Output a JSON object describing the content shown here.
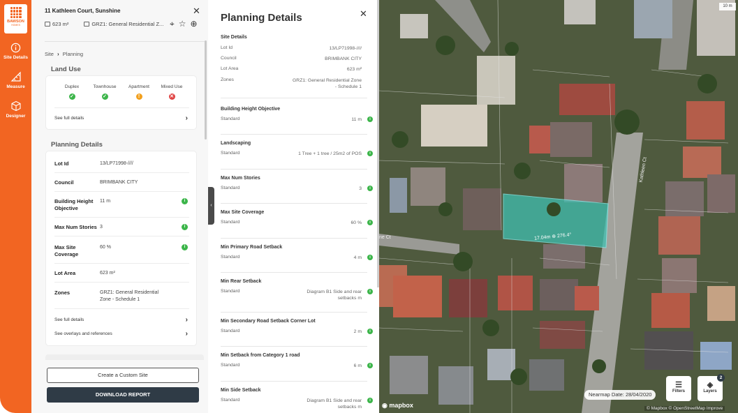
{
  "brand": {
    "line1": "BAWSON",
    "line2": "HOMES"
  },
  "rail": {
    "items": [
      {
        "label": "Site Details"
      },
      {
        "label": "Measure"
      },
      {
        "label": "Designer"
      }
    ]
  },
  "site": {
    "address": "11 Kathleen Court, Sunshine",
    "area": "623 m²",
    "zone_short": "GRZ1: General Residential Z..."
  },
  "breadcrumb": {
    "first": "Site",
    "second": "Planning"
  },
  "land_use": {
    "title": "Land Use",
    "items": [
      {
        "label": "Duplex",
        "status": "green",
        "glyph": "✓"
      },
      {
        "label": "Townhouse",
        "status": "green",
        "glyph": "✓"
      },
      {
        "label": "Apartment",
        "status": "orange",
        "glyph": "!"
      },
      {
        "label": "Mixed Use",
        "status": "red",
        "glyph": "✕"
      }
    ],
    "see_full": "See full details"
  },
  "planning": {
    "title": "Planning Details",
    "rows": [
      {
        "key": "Lot Id",
        "value": "13/LP71998-////"
      },
      {
        "key": "Council",
        "value": "BRIMBANK CITY"
      },
      {
        "key": "Building Height Objective",
        "value": "11 m"
      },
      {
        "key": "Max Num Stories",
        "value": "3"
      },
      {
        "key": "Max Site Coverage",
        "value": "60 %"
      },
      {
        "key": "Lot Area",
        "value": "623 m²"
      },
      {
        "key": "Zones",
        "value": "GRZ1: General Residential Zone - Schedule 1"
      }
    ],
    "see_full": "See full details",
    "see_overlays": "See overlays and references"
  },
  "actions": {
    "custom_site": "Create a Custom Site",
    "download": "DOWNLOAD REPORT"
  },
  "panel": {
    "title": "Planning Details",
    "site_details_title": "Site Details",
    "site_rows": [
      {
        "key": "Lot Id",
        "value": "13/LP71998-////"
      },
      {
        "key": "Council",
        "value": "BRIMBANK CITY"
      },
      {
        "key": "Lot Area",
        "value": "623 m²"
      },
      {
        "key": "Zones",
        "value": "GRZ1: General Residential Zone - Schedule 1"
      }
    ],
    "sections": [
      {
        "title": "Building Height Objective",
        "label": "Standard",
        "value": "11 m"
      },
      {
        "title": "Landscaping",
        "label": "Standard",
        "value": "1 Tree + 1 tree / 25m2 of POS"
      },
      {
        "title": "Max Num Stories",
        "label": "Standard",
        "value": "3"
      },
      {
        "title": "Max Site Coverage",
        "label": "Standard",
        "value": "60 %"
      },
      {
        "title": "Min Primary Road Setback",
        "label": "Standard",
        "value": "4 m"
      },
      {
        "title": "Min Rear Setback",
        "label": "Standard",
        "value": "Diagram B1 Side and rear setbacks m"
      },
      {
        "title": "Min Secondary Road Setback Corner Lot",
        "label": "Standard",
        "value": "2 m"
      },
      {
        "title": "Min Setback from Category 1 road",
        "label": "Standard",
        "value": "6 m"
      },
      {
        "title": "Min Side Setback",
        "label": "Standard",
        "value": "Diagram B1 Side and rear setbacks m"
      }
    ]
  },
  "map": {
    "scale": "10 m",
    "nearmap_date": "Nearmap Date: 28/04/2020",
    "filters_label": "Filters",
    "layers_label": "Layers",
    "layers_badge": "2",
    "mapbox": "mapbox",
    "attribution": "© Mapbox © OpenStreetMap Improve",
    "dimension": "17.04m ⊕ 276.4°",
    "street_a": "ne Ct",
    "street_b": "Kathleen Ct",
    "lot_color": "#3fbfb0"
  }
}
